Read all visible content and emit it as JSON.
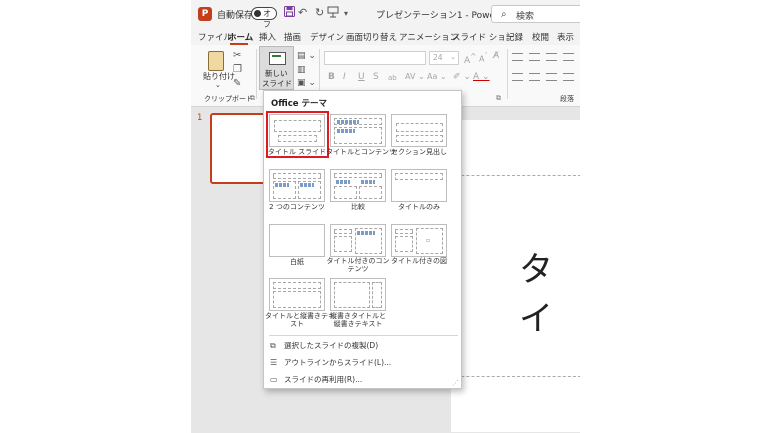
{
  "titlebar": {
    "app_logo": "P",
    "autosave_label": "自動保存",
    "autosave_state": "オフ",
    "doc_title": "プレゼンテーション1 - Power…",
    "search_placeholder": "検索",
    "qat_icons": [
      "save-icon",
      "undo-icon",
      "redo-icon",
      "present-icon",
      "chevron-down-icon"
    ]
  },
  "menu": {
    "tabs": [
      "ファイル",
      "ホーム",
      "挿入",
      "描画",
      "デザイン",
      "画面切り替え",
      "アニメーション",
      "スライド ショー",
      "記録",
      "校閲",
      "表示"
    ],
    "active": "ホーム"
  },
  "ribbon": {
    "paste_label": "貼り付け",
    "clipboard_group": "クリップボード",
    "new_slide_label_1": "新しい",
    "new_slide_label_2": "スライド",
    "font_size": "24",
    "bold": "B",
    "italic": "I",
    "underline": "U",
    "strike": "S",
    "paragraph_group": "段落"
  },
  "thumbnails": {
    "slide_number": "1"
  },
  "canvas": {
    "title_text": "タイ"
  },
  "layout_menu": {
    "header": "Office テーマ",
    "layouts": [
      {
        "name": "タイトル スライド"
      },
      {
        "name": "タイトルとコンテンツ"
      },
      {
        "name": "セクション見出し"
      },
      {
        "name": "2 つのコンテンツ"
      },
      {
        "name": "比較"
      },
      {
        "name": "タイトルのみ"
      },
      {
        "name": "白紙"
      },
      {
        "name_line1": "タイトル付きのコン",
        "name_line2": "テンツ"
      },
      {
        "name": "タイトル付きの図"
      },
      {
        "name_line1": "タイトルと縦書きテキ",
        "name_line2": "スト"
      },
      {
        "name_line1": "縦書きタイトルと",
        "name_line2": "縦書きテキスト"
      }
    ],
    "selected": "タイトル スライド",
    "actions": [
      {
        "label": "選択したスライドの複製(D)",
        "icon": "duplicate-slide-icon"
      },
      {
        "label": "アウトラインからスライド(L)...",
        "icon": "outline-icon"
      },
      {
        "label": "スライドの再利用(R)...",
        "icon": "reuse-slides-icon"
      }
    ]
  },
  "colors": {
    "accent": "#c43e1c",
    "selection": "#e01a22"
  }
}
